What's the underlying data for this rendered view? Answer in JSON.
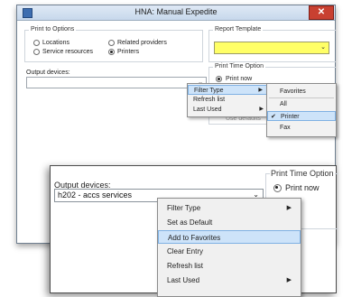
{
  "dialog": {
    "title": "HNA: Manual Expedite",
    "print_to": {
      "label": "Print to Options",
      "options": [
        {
          "label": "Locations",
          "selected": false
        },
        {
          "label": "Related providers",
          "selected": false
        },
        {
          "label": "Service resources",
          "selected": false
        },
        {
          "label": "Printers",
          "selected": true
        }
      ]
    },
    "report_template": {
      "label": "Report Template",
      "value": ""
    },
    "output_devices_label": "Output devices:",
    "output_devices_value": "",
    "print_time": {
      "label": "Print Time Option",
      "print_now": "Print now",
      "obscured_option": "Use defaults"
    },
    "context_menu": [
      {
        "label": "Filter Type",
        "has_submenu": true,
        "highlighted": true
      },
      {
        "label": "Refresh list",
        "has_submenu": false,
        "highlighted": false
      },
      {
        "label": "Last Used",
        "has_submenu": true,
        "highlighted": false
      }
    ],
    "filter_submenu": [
      {
        "label": "Favorites",
        "checked": false,
        "highlighted": false
      },
      {
        "label": "All",
        "checked": false,
        "highlighted": false
      },
      {
        "label": "Printer",
        "checked": true,
        "highlighted": true
      },
      {
        "label": "Fax",
        "checked": false,
        "highlighted": false
      }
    ]
  },
  "zoom_panel": {
    "output_devices_label": "Output devices:",
    "output_devices_value": "h202 - accs services",
    "print_time_label": "Print Time Option",
    "print_now": "Print now",
    "context_menu": [
      {
        "label": "Filter Type",
        "has_submenu": true,
        "highlighted": false
      },
      {
        "label": "Set as Default",
        "has_submenu": false,
        "highlighted": false
      },
      {
        "label": "Add to Favorites",
        "has_submenu": false,
        "highlighted": true
      },
      {
        "label": "Clear Entry",
        "has_submenu": false,
        "highlighted": false
      },
      {
        "label": "Refresh list",
        "has_submenu": false,
        "highlighted": false
      },
      {
        "label": "Last Used",
        "has_submenu": true,
        "highlighted": false
      }
    ]
  },
  "colors": {
    "required_field": "#ffff66",
    "close_button": "#c84031",
    "menu_highlight": "#cde3f9"
  }
}
